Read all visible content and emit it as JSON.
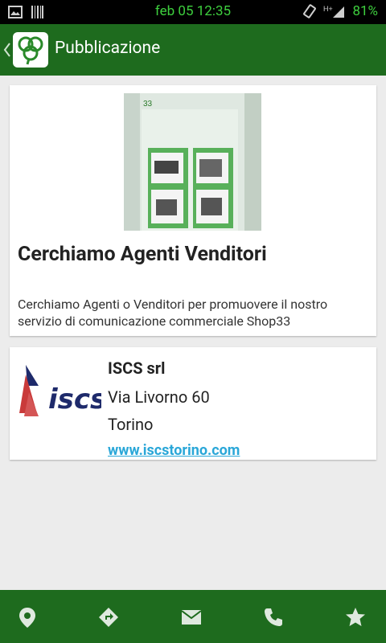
{
  "status_bar": {
    "time": "feb 05 12:35",
    "battery": "81%"
  },
  "app_bar": {
    "title": "Pubblicazione"
  },
  "post": {
    "title": "Cerchiamo Agenti Venditori",
    "description": "Cerchiamo Agenti o Venditori per promuovere il nostro servizio di comunicazione commerciale Shop33"
  },
  "company": {
    "name": "ISCS srl",
    "address": "Via Livorno 60",
    "city": "Torino",
    "website": "www.iscstorino.com",
    "logo_text": "iscs"
  },
  "colors": {
    "primary": "#1e6b1e",
    "status_green": "#3ecf3e",
    "link": "#2aa7d8",
    "background": "#ececec"
  },
  "bottom_nav": [
    {
      "icon": "location-pin-icon"
    },
    {
      "icon": "directions-icon"
    },
    {
      "icon": "email-icon"
    },
    {
      "icon": "phone-icon"
    },
    {
      "icon": "star-icon"
    }
  ]
}
